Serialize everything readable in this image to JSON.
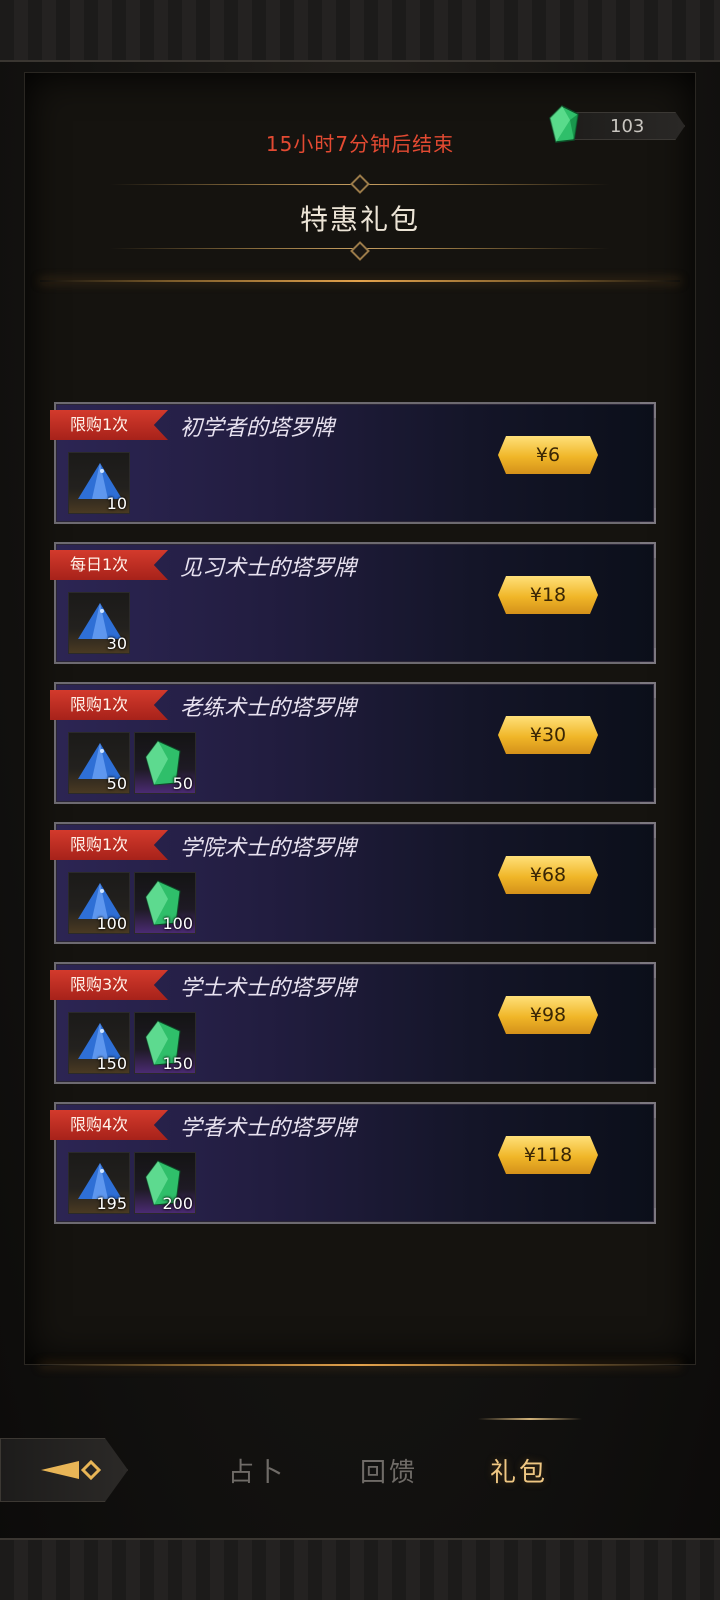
{
  "header": {
    "countdown": "15小时7分钟后结束",
    "gem_balance": "103",
    "title": "特惠礼包"
  },
  "packages": [
    {
      "limit": "限购1次",
      "name": "初学者的塔罗牌",
      "price": "¥6",
      "items": [
        {
          "icon": "blue-crystal-icon",
          "qty": "10"
        }
      ]
    },
    {
      "limit": "每日1次",
      "name": "见习术士的塔罗牌",
      "price": "¥18",
      "items": [
        {
          "icon": "blue-crystal-icon",
          "qty": "30"
        }
      ]
    },
    {
      "limit": "限购1次",
      "name": "老练术士的塔罗牌",
      "price": "¥30",
      "items": [
        {
          "icon": "blue-crystal-icon",
          "qty": "50"
        },
        {
          "icon": "green-gem-icon",
          "qty": "50"
        }
      ]
    },
    {
      "limit": "限购1次",
      "name": "学院术士的塔罗牌",
      "price": "¥68",
      "items": [
        {
          "icon": "blue-crystal-icon",
          "qty": "100"
        },
        {
          "icon": "green-gem-icon",
          "qty": "100"
        }
      ]
    },
    {
      "limit": "限购3次",
      "name": "学士术士的塔罗牌",
      "price": "¥98",
      "items": [
        {
          "icon": "blue-crystal-icon",
          "qty": "150"
        },
        {
          "icon": "green-gem-icon",
          "qty": "150"
        }
      ]
    },
    {
      "limit": "限购4次",
      "name": "学者术士的塔罗牌",
      "price": "¥118",
      "items": [
        {
          "icon": "blue-crystal-icon",
          "qty": "195"
        },
        {
          "icon": "green-gem-icon",
          "qty": "200"
        }
      ]
    }
  ],
  "nav": {
    "tabs": [
      {
        "label": "占卜",
        "active": false
      },
      {
        "label": "回馈",
        "active": false
      },
      {
        "label": "礼包",
        "active": true
      }
    ],
    "back_icon": "arrow-back-icon"
  },
  "colors": {
    "countdown": "#e34a32",
    "limit_tag": "#c9302a",
    "price_gold": "#f0b628",
    "active_tab": "#efc783"
  }
}
